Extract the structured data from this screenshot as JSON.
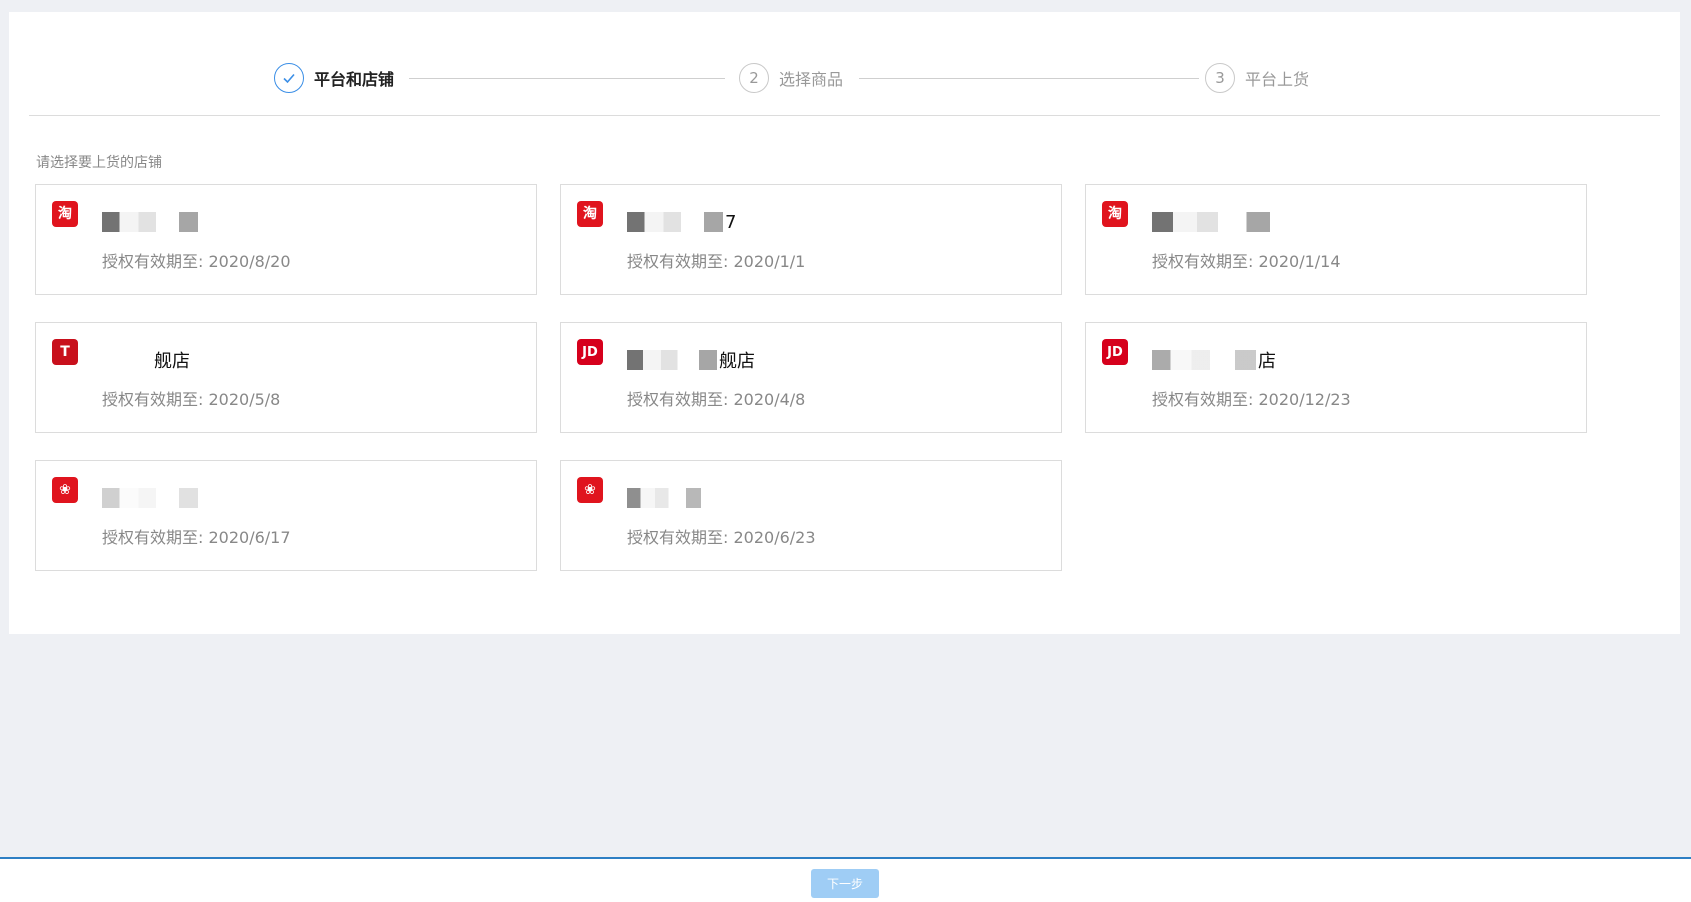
{
  "steps": [
    {
      "number": "✓",
      "label": "平台和店铺",
      "state": "done"
    },
    {
      "number": "2",
      "label": "选择商品",
      "state": "pending"
    },
    {
      "number": "3",
      "label": "平台上货",
      "state": "pending"
    }
  ],
  "hint": "请选择要上货的店铺",
  "shops": [
    {
      "platform_icon": "taobao-icon",
      "icon_text": "淘",
      "name": "",
      "expiry": "授权有效期至: 2020/8/20"
    },
    {
      "platform_icon": "taobao-icon",
      "icon_text": "淘",
      "name": "7",
      "expiry": "授权有效期至: 2020/1/1"
    },
    {
      "platform_icon": "taobao-icon",
      "icon_text": "淘",
      "name": "",
      "expiry": "授权有效期至: 2020/1/14"
    },
    {
      "platform_icon": "tmall-icon",
      "icon_text": "T",
      "name": "舰店",
      "expiry": "授权有效期至: 2020/5/8"
    },
    {
      "platform_icon": "jd-icon",
      "icon_text": "JD",
      "name": "舰店",
      "expiry": "授权有效期至: 2020/4/8"
    },
    {
      "platform_icon": "jd-icon",
      "icon_text": "JD",
      "name": "店",
      "expiry": "授权有效期至: 2020/12/23"
    },
    {
      "platform_icon": "pinduoduo-icon",
      "icon_text": "❀",
      "name": "",
      "expiry": "授权有效期至: 2020/6/17"
    },
    {
      "platform_icon": "pinduoduo-icon",
      "icon_text": "❀",
      "name": "",
      "expiry": "授权有效期至: 2020/6/23"
    }
  ],
  "footer": {
    "next_label": "下一步"
  },
  "colors": {
    "accent": "#3a8ee6",
    "platform_red": "#e0141e",
    "button_disabled": "#9fcdf5"
  }
}
